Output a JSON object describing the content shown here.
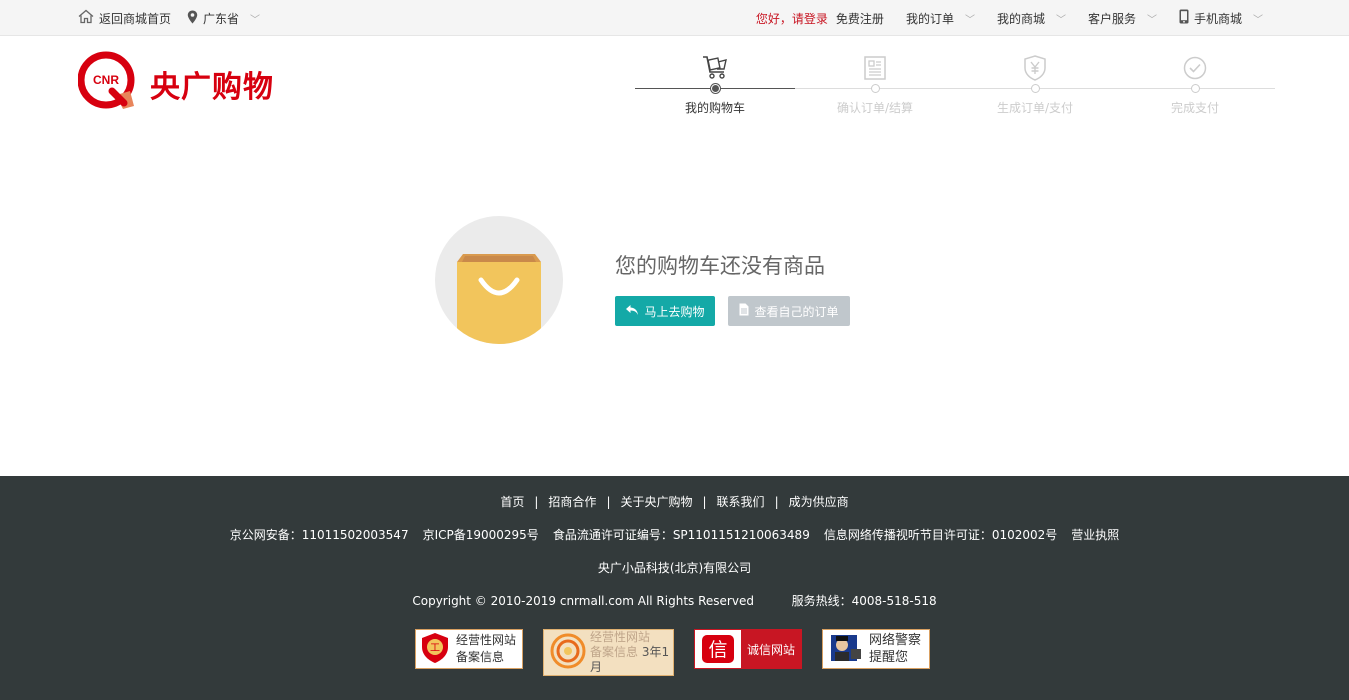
{
  "topbar": {
    "home": "返回商城首页",
    "location": "广东省",
    "greeting": "您好，请登录",
    "register": "免费注册",
    "orders": "我的订单",
    "my_mall": "我的商城",
    "service": "客户服务",
    "mobile": "手机商城"
  },
  "logo": {
    "badge": "CNR",
    "name": "央广购物"
  },
  "steps": [
    {
      "label": "我的购物车",
      "icon": "cart-icon"
    },
    {
      "label": "确认订单/结算",
      "icon": "document-icon"
    },
    {
      "label": "生成订单/支付",
      "icon": "yen-shield-icon"
    },
    {
      "label": "完成支付",
      "icon": "check-circle-icon"
    }
  ],
  "empty": {
    "title": "您的购物车还没有商品",
    "go_shopping": "马上去购物",
    "view_orders": "查看自己的订单"
  },
  "footer": {
    "links": [
      "首页",
      "招商合作",
      "关于央广购物",
      "联系我们",
      "成为供应商"
    ],
    "link_sep": "|",
    "licenses": [
      "京公网安备：11011502003547",
      "京ICP备19000295号",
      "食品流通许可证编号：SP1101151210063489",
      "信息网络传播视听节目许可证：0102002号",
      "营业执照"
    ],
    "company": "央广小品科技(北京)有限公司",
    "copyright": "Copyright © 2010-2019  cnrmall.com  All  Rights  Reserved",
    "hotline": "服务热线：4008-518-518",
    "badges": {
      "b1_line1": "经营性网站",
      "b1_line2": "备案信息",
      "b2_line1": "经营性网站",
      "b2_line2": "备案信息",
      "b2_tag": "3年1月",
      "b3_text": "诚信网站",
      "b4_line1": "网络警察",
      "b4_line2": "提醒您"
    }
  },
  "colors": {
    "brand_red": "#d7000f",
    "accent_teal": "#14a9a7",
    "footer_bg": "#333a3b",
    "bag_yellow": "#f2c55c"
  }
}
